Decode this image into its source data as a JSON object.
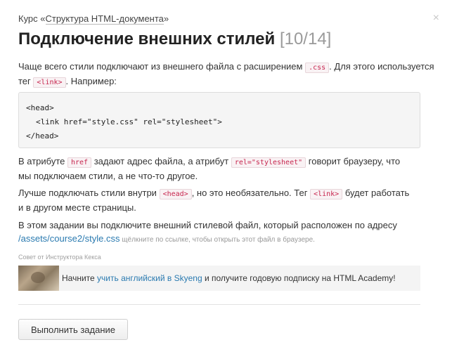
{
  "header": {
    "course_prefix": "Курс «",
    "course_name": "Структура HTML-документа",
    "course_suffix": "»",
    "close_glyph": "×"
  },
  "title": {
    "text": "Подключение внешних стилей",
    "counter": "[10/14]"
  },
  "intro": {
    "part1": "Чаще всего стили подключают из внешнего файла с расширением ",
    "code1": ".css",
    "part2": ". Для этого используется тег ",
    "code2": "<link>",
    "part3": ". Например:"
  },
  "code_block": {
    "line1": "<head>",
    "line2": "<link href=\"style.css\" rel=\"stylesheet\">",
    "line3": "</head>"
  },
  "para_href": {
    "part1": "В атрибуте ",
    "code1": "href",
    "part2": " задают адрес файла, а атрибут ",
    "code2": "rel=\"stylesheet\"",
    "part3": " говорит браузеру, что",
    "part4": "мы подключаем стили, а не что-то другое."
  },
  "para_head": {
    "part1": "Лучше подключать стили внутри ",
    "code1": "<head>",
    "part2": ", но это необязательно. Тег ",
    "code2": "<link>",
    "part3": " будет работать",
    "part4": "и в другом месте страницы."
  },
  "para_task": {
    "part1": "В этом задании вы подключите внешний стилевой файл, который расположен по адресу",
    "link": "/assets/course2/style.css",
    "hint": " щёлкните по ссылке, чтобы открыть этот файл в браузере."
  },
  "tip": {
    "label": "Совет от Инструктора Кекса",
    "text_before": "Начните ",
    "link": "учить английский в Skyeng",
    "text_after": " и получите годовую подписку на HTML Academy!"
  },
  "actions": {
    "submit_label": "Выполнить задание"
  }
}
